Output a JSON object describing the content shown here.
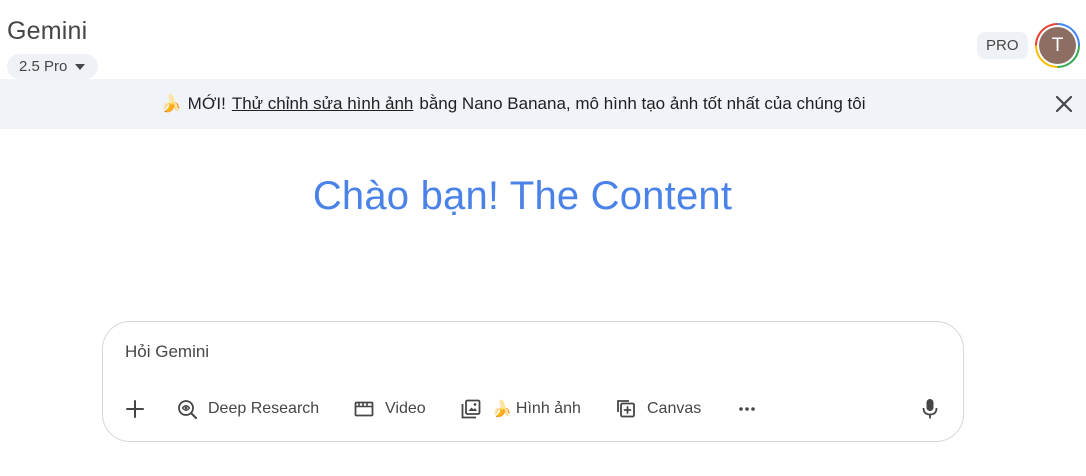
{
  "header": {
    "brand": "Gemini",
    "model_label": "2.5 Pro",
    "pro_badge": "PRO",
    "avatar_initial": "T"
  },
  "banner": {
    "emoji": "🍌",
    "prefix": "MỚI!",
    "link_text": "Thử chỉnh sửa hình ảnh",
    "rest": "bằng Nano Banana, mô hình tạo ảnh tốt nhất của chúng tôi"
  },
  "greeting": "Chào bạn! The Content",
  "composer": {
    "placeholder": "Hỏi Gemini",
    "tools": {
      "deep_research": "Deep Research",
      "video": "Video",
      "image_emoji": "🍌",
      "image": "Hình ảnh",
      "canvas": "Canvas"
    }
  },
  "colors": {
    "greeting": "#4a82e8",
    "banner_bg": "#f0f4f9",
    "chip_bg": "#eef1f5",
    "avatar_bg": "#8d6e63"
  },
  "icons": [
    "chevron-down-icon",
    "close-icon",
    "plus-icon",
    "deep-research-icon",
    "video-icon",
    "image-gallery-icon",
    "canvas-icon",
    "more-icon",
    "microphone-icon"
  ]
}
